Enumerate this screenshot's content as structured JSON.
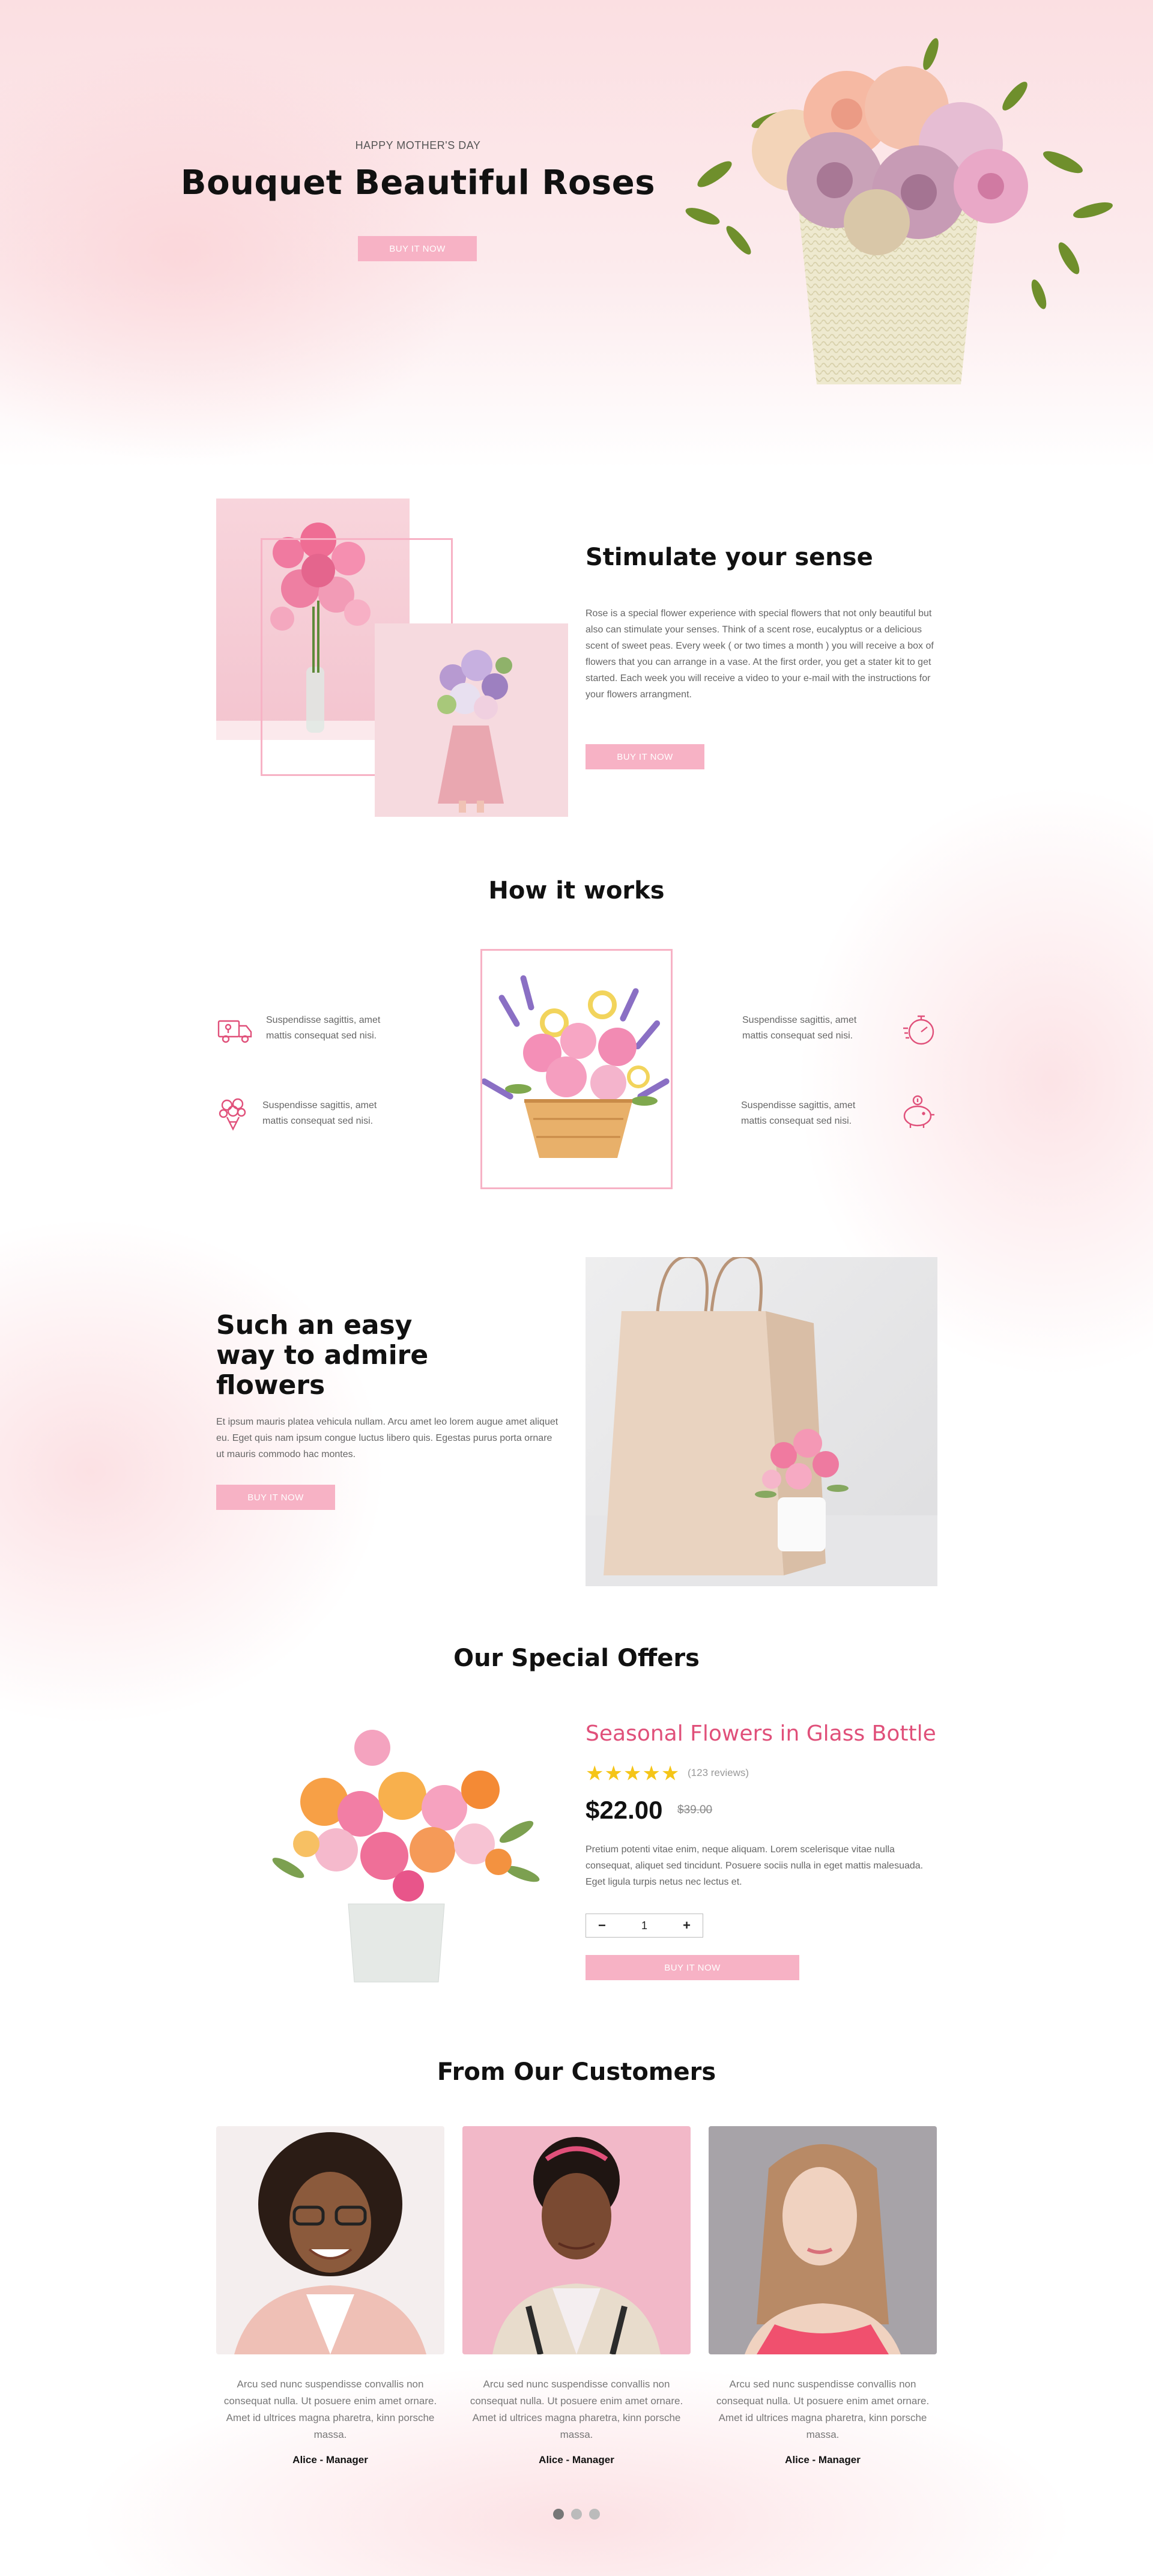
{
  "colors": {
    "accent": "#f7b2c5",
    "title_pink": "#e0507a",
    "star": "#f5c518"
  },
  "hero": {
    "eyebrow": "HAPPY MOTHER'S DAY",
    "title": "Bouquet Beautiful Roses",
    "button": "BUY IT NOW"
  },
  "stimulate": {
    "title": "Stimulate your sense",
    "body": "Rose is a special flower experience with special flowers that not only beautiful but also can stimulate your senses. Think of a scent rose, eucalyptus or a delicious scent of sweet peas. Every week ( or two times a month ) you will receive a box of flowers that you can arrange in a vase. At the first order, you get a stater kit  to get started.  Each week you will receive a video to your e-mail with the instructions for your flowers arrangment.",
    "button": "BUY IT NOW"
  },
  "how": {
    "title": "How it works",
    "steps": [
      {
        "icon": "delivery-truck-icon",
        "text": "Suspendisse sagittis, amet mattis consequat sed nisi."
      },
      {
        "icon": "flower-bouquet-icon",
        "text": "Suspendisse sagittis, amet mattis consequat sed nisi."
      },
      {
        "icon": "stopwatch-icon",
        "text": "Suspendisse sagittis, amet mattis consequat sed nisi."
      },
      {
        "icon": "piggy-bank-icon",
        "text": "Suspendisse sagittis, amet mattis consequat sed nisi."
      }
    ]
  },
  "easy": {
    "title_lines": [
      "Such an easy",
      "way to admire",
      "flowers"
    ],
    "body": "Et ipsum mauris platea vehicula nullam. Arcu amet leo lorem augue amet aliquet eu. Eget quis nam ipsum congue luctus libero quis. Egestas purus porta ornare ut mauris commodo hac montes.",
    "button": "BUY IT NOW"
  },
  "offers": {
    "title": "Our Special Offers",
    "product_name": "Seasonal Flowers in Glass Bottle",
    "rating": 5,
    "reviews": "(123 reviews)",
    "price": "$22.00",
    "old_price": "$39.00",
    "description": "Pretium potenti vitae enim, neque aliquam. Lorem scelerisque vitae nulla consequat, aliquet sed tincidunt. Posuere sociis nulla in eget mattis malesuada. Eget ligula turpis netus nec lectus et.",
    "minus": "−",
    "quantity": "1",
    "plus": "+",
    "button": "BUY IT NOW"
  },
  "customers": {
    "title": "From Our Customers",
    "items": [
      {
        "quote": "Arcu sed nunc suspendisse convallis non consequat nulla. Ut posuere enim amet ornare. Amet id ultrices magna pharetra, kinn porsche massa.",
        "name": "Alice - Manager"
      },
      {
        "quote": "Arcu sed nunc suspendisse convallis non consequat nulla. Ut posuere enim amet ornare. Amet id ultrices magna pharetra, kinn porsche massa.",
        "name": "Alice - Manager"
      },
      {
        "quote": "Arcu sed nunc suspendisse convallis non consequat nulla. Ut posuere enim amet ornare. Amet id ultrices magna pharetra, kinn porsche massa.",
        "name": "Alice - Manager"
      }
    ],
    "slides": 3,
    "active_slide": 1
  }
}
